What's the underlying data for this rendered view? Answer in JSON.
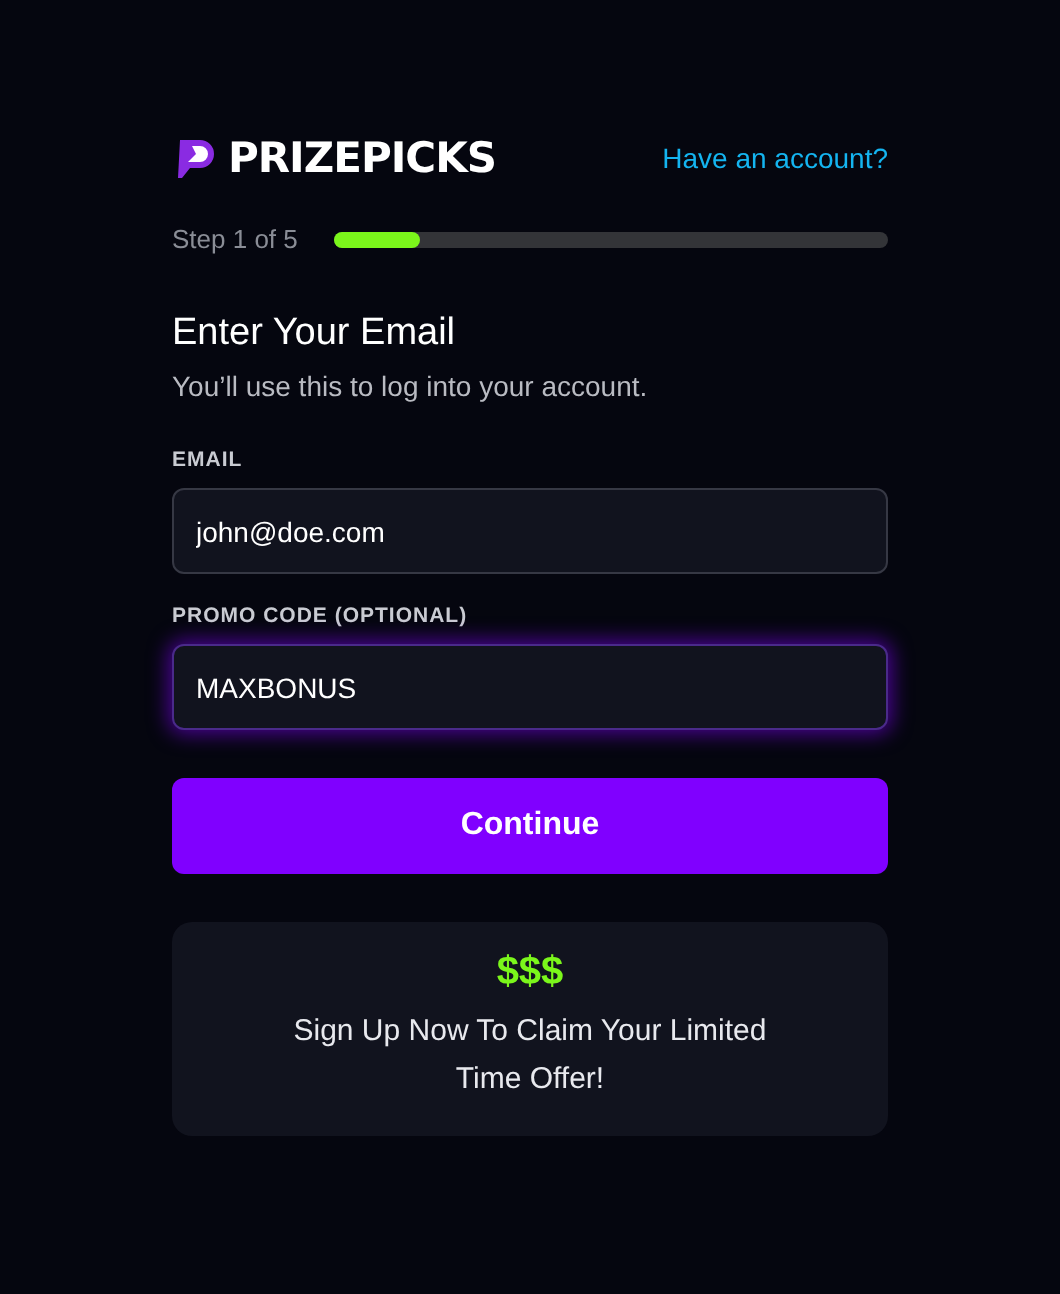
{
  "header": {
    "logo_text": "PRIZEPICKS",
    "login_link": "Have an account?"
  },
  "progress": {
    "label": "Step 1 of 5",
    "level": 0.155
  },
  "title": "Enter Your Email",
  "subtitle": "You’ll use this to log into your account.",
  "fields": [
    {
      "label": "EMAIL",
      "value": "john@doe.com",
      "focused": false
    },
    {
      "label": "PROMO CODE (OPTIONAL)",
      "value": "MAXBONUS",
      "focused": true
    }
  ],
  "continue_button": "Continue",
  "offer": {
    "symbol": "$$$",
    "text": "Sign Up Now To Claim Your Limited Time Offer!"
  }
}
